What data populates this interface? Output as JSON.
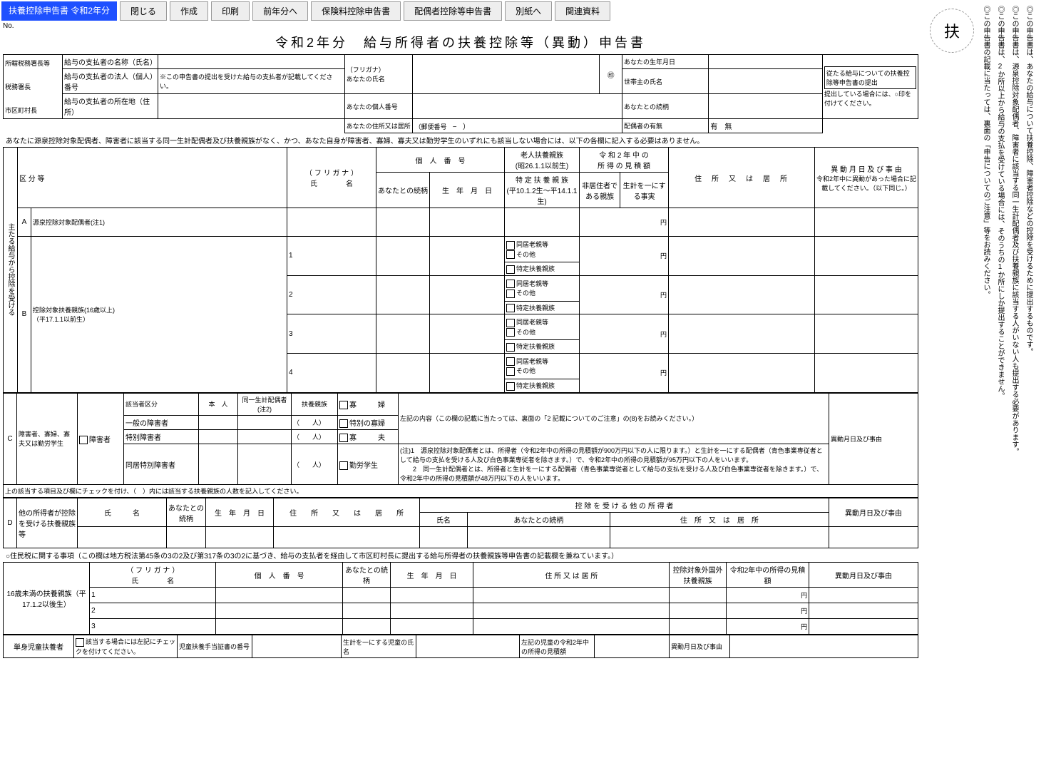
{
  "toolbar": {
    "tab": "扶養控除申告書 令和2年分",
    "close": "閉じる",
    "create": "作成",
    "print": "印刷",
    "prev": "前年分へ",
    "ins": "保険料控除申告書",
    "spouse": "配偶者控除等申告書",
    "appendix": "別紙へ",
    "related": "関連資料"
  },
  "doc": {
    "no": "No.",
    "title": "令和2年分　給与所得者の扶養控除等（異動）申告書",
    "instructionLine": "あなたに源泉控除対象配偶者、障害者に該当する同一生計配偶者及び扶養親族がなく、かつ、あなた自身が障害者、寡婦、寡夫又は勤労学生のいずれにも該当しない場合には、以下の各欄に記入する必要はありません。",
    "residentTaxNote": "○住民税に関する事項（この欄は地方税法第45条の3の2及び第317条の3の2に基づき、給与の支払者を経由して市区町村長に提出する給与所得者の扶養親族等申告書の記載欄を兼ねています。）"
  },
  "upper": {
    "l1": "所轄税務署長等",
    "l2": "税務署長",
    "l3": "市区町村長",
    "pname": "給与の支払者の名称（氏名）",
    "pno": "給与の支払者の法人（個人）番号",
    "pnoNote": "※この申告書の提出を受けた給与の支払者が記載してください。",
    "paddr": "給与の支払者の所在地（住所）",
    "furi": "（フリガナ）",
    "yourname": "あなたの氏名",
    "yournumber": "あなたの個人番号",
    "youraddr": "あなたの住所又は居所",
    "postal": "（郵便番号",
    "dash": "−",
    "close": "）",
    "birth": "あなたの生年月日",
    "seal": "㊞",
    "headname": "世帯主の氏名",
    "rel": "あなたとの続柄",
    "spousePresence": "配偶者の有無",
    "yes": "有",
    "no": "無",
    "submitNote": "従たる給与についての扶養控除等申告書の提出",
    "submitNote2": "提出している場合には、○印を付けてください。"
  },
  "tableA": {
    "colKubun": "区 分 等",
    "colFuri": "（ フ リ ガ ナ ）",
    "colName": "氏　　　　名",
    "colNo": "個　人　番　号",
    "colRel": "あなたとの続柄",
    "colBirth": "生　年　月　日",
    "colElder": "老人扶養親族",
    "colElderSub": "(昭26.1.1以前生)",
    "colSpec": "特 定 扶 養 親 族",
    "colSpecSub": "(平10.1.2生～平14.1.1生)",
    "colIncome": "令 和 2 年 中 の",
    "colIncome2": "所 得 の 見 積 額",
    "colNonres": "非居住者である親族",
    "colSame": "生計を一にする事実",
    "colAddr": "住　所　又　は　居　所",
    "colChange": "異 動 月 日 及 び 事 由",
    "colChangeSub": "令和2年中に異動があった場合に記載してください。（以下同じ。）",
    "rowA": "A",
    "rowAName": "源泉控除対象配偶者(注1)",
    "sideMain": "主たる給与から控除を受ける",
    "rowB": "B",
    "rowBName": "控除対象扶養親族(16歳以上)",
    "rowBSub": "（平17.1.1以前生）",
    "chkDoukyo": "同居老親等",
    "chkOther": "その他",
    "chkTokutei": "特定扶養親族",
    "yen": "円"
  },
  "tableC": {
    "row": "C",
    "name": "障害者、寡婦、寡夫又は勤労学生",
    "chkShogai": "障害者",
    "hdr1": "該当者区分",
    "hdr2": "本　人",
    "hdr3": "同一生計配偶者(注2)",
    "hdr4": "扶養親族",
    "g1": "一般の障害者",
    "g2": "特別障害者",
    "g3": "同居特別障害者",
    "chkKafu": "寡　　　婦",
    "chkToku": "特別の寡婦",
    "chkKafu2": "寡　　　夫",
    "chkKinro": "勤労学生",
    "noteLeft": "左記の内容（この欄の記載に当たっては、裏面の「2 記載についてのご注意」の(8)をお読みください。）",
    "colChange": "異動月日及び事由",
    "bottomNote": "上の該当する項目及び欄にチェックを付け、（　）内には該当する扶養親族の人数を記入してください。",
    "note1": "(注)1　源泉控除対象配偶者とは、所得者（令和2年中の所得の見積額が900万円以下の人に限ります。）と生計を一にする配偶者（青色事業専従者として給与の支払を受ける人及び白色事業専従者を除きます。）で、令和2年中の所得の見積額が95万円以下の人をいいます。",
    "note2": "　　2　同一生計配偶者とは、所得者と生計を一にする配偶者（青色事業専従者として給与の支払を受ける人及び白色事業専従者を除きます。）で、令和2年中の所得の見積額が48万円以下の人をいいます。",
    "ppl": "（　　人）"
  },
  "tableD": {
    "row": "D",
    "name": "他の所得者が控除を受ける扶養親族等",
    "h1": "氏　　　名",
    "h2": "あなたとの続柄",
    "h3": "生　年　月　日",
    "h4": "住　　所　　又　　は　　居　　所",
    "h5": "控 除 を 受 け る 他 の 所 得 者",
    "h5a": "氏名",
    "h5b": "あなたとの続柄",
    "h5c": "住　所　又　は　居　所",
    "h6": "異動月日及び事由"
  },
  "tableU16": {
    "name": "16歳未満の扶養親族（平17.1.2以後生）",
    "h1": "（ フ リ ガ ナ ）",
    "h2": "氏　　　　名",
    "h3": "個　人　番　号",
    "h4": "あなたとの続柄",
    "h5": "生　年　月　日",
    "h6": "住 所 又 は 居 所",
    "h7": "控除対象外国外扶養親族",
    "h8": "令和2年中の所得の見積額",
    "h9": "異動月日及び事由",
    "yen": "円"
  },
  "single": {
    "label": "単身児童扶養者",
    "chk": "該当する場合には左記にチェックを付けてください。",
    "h1": "児童扶養手当証書の番号",
    "h2": "生計を一にする児童の氏名",
    "h3": "左記の児童の令和2年中の所得の見積額",
    "h4": "異動月日及び事由"
  },
  "side": {
    "stamp": "扶",
    "s1": "◎この申告書は、あなたの給与について扶養控除、障害者控除などの控除を受けるために提出するものです。",
    "s2": "◎この申告書は、源泉控除対象配偶者、障害者に該当する同一生計配偶者及び扶養親族に該当する人がいない人も提出する必要があります。",
    "s3": "◎この申告書は、2か所以上から給与の支払を受けている場合には、そのうちの1か所にしか提出することができません。",
    "s4": "◎この申告書の記載に当たっては、裏面の「申告についてのご注意」等をお読みください。"
  }
}
